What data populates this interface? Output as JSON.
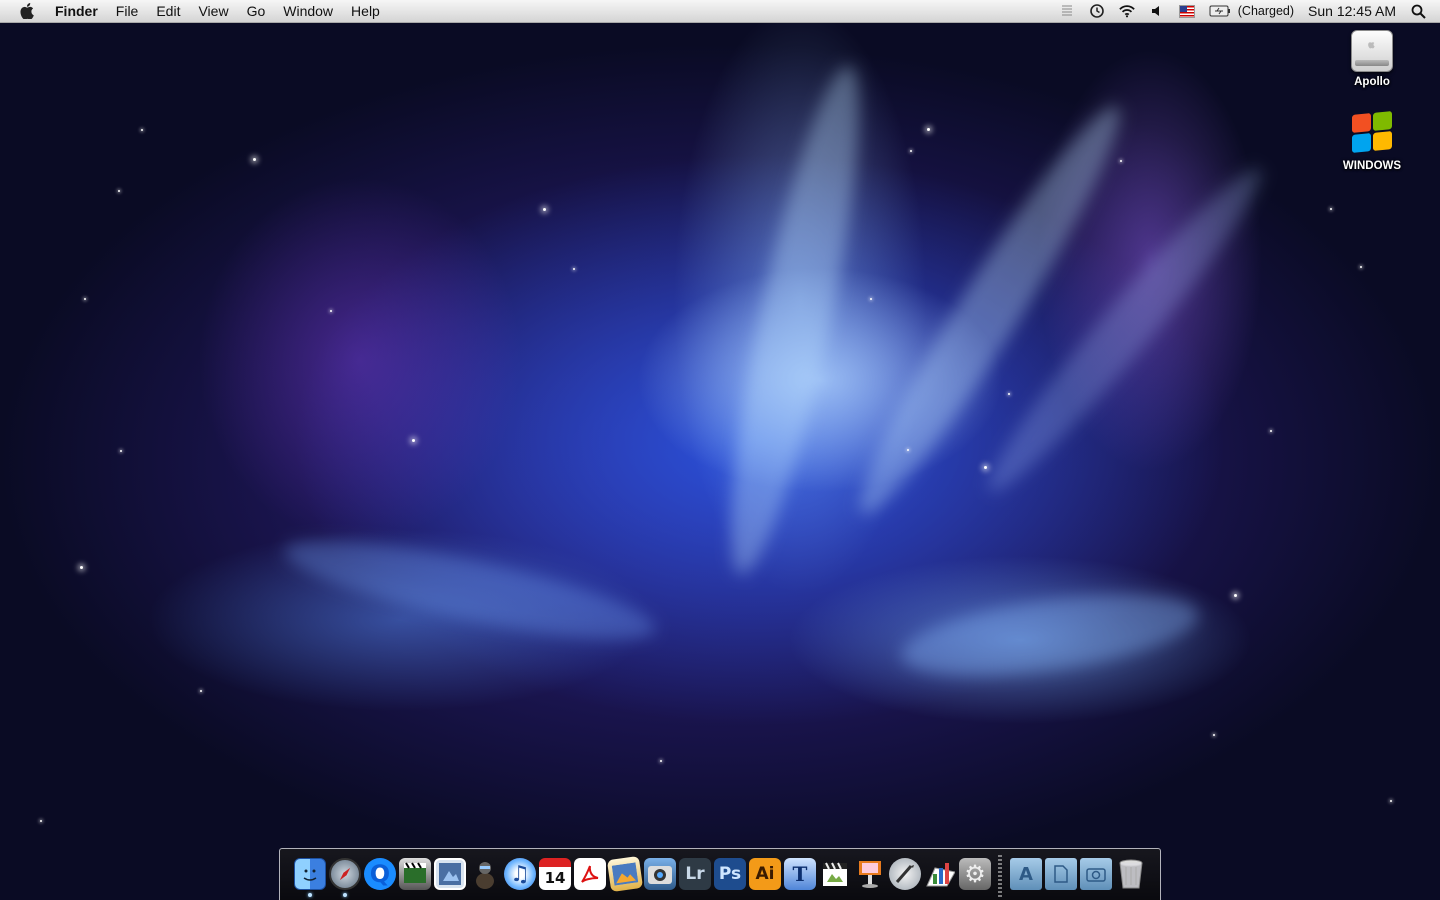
{
  "menubar": {
    "apple_icon": "apple-logo-icon",
    "app_name": "Finder",
    "menus": [
      "File",
      "Edit",
      "View",
      "Go",
      "Window",
      "Help"
    ],
    "status": {
      "battery_text": "(Charged)",
      "clock": "Sun 12:45 AM",
      "icons": [
        "menu-extra-icon",
        "time-machine-icon",
        "wifi-icon",
        "volume-icon",
        "us-flag-input-icon",
        "battery-icon",
        "spotlight-icon"
      ]
    }
  },
  "desktop": {
    "icons": [
      {
        "label": "Apollo",
        "icon": "hard-drive-icon"
      },
      {
        "label": "WINDOWS",
        "icon": "windows-drive-icon"
      }
    ]
  },
  "dock": {
    "items": [
      {
        "name": "finder",
        "glyph": ""
      },
      {
        "name": "safari",
        "glyph": ""
      },
      {
        "name": "quicktime",
        "glyph": "Q"
      },
      {
        "name": "imovie",
        "glyph": ""
      },
      {
        "name": "preview",
        "glyph": ""
      },
      {
        "name": "automator",
        "glyph": ""
      },
      {
        "name": "itunes",
        "glyph": "♫"
      },
      {
        "name": "ical",
        "glyph": "14"
      },
      {
        "name": "acrobat",
        "glyph": ""
      },
      {
        "name": "iphoto",
        "glyph": ""
      },
      {
        "name": "image-capture",
        "glyph": ""
      },
      {
        "name": "lightroom",
        "glyph": "Lr"
      },
      {
        "name": "photoshop",
        "glyph": "Ps"
      },
      {
        "name": "illustrator",
        "glyph": "Ai"
      },
      {
        "name": "textedit",
        "glyph": "T"
      },
      {
        "name": "final-cut",
        "glyph": ""
      },
      {
        "name": "keynote",
        "glyph": ""
      },
      {
        "name": "script-editor",
        "glyph": ""
      },
      {
        "name": "numbers",
        "glyph": ""
      },
      {
        "name": "system-preferences",
        "glyph": "⚙"
      },
      {
        "name": "applications-folder",
        "glyph": "A"
      },
      {
        "name": "documents-folder",
        "glyph": ""
      },
      {
        "name": "pictures-folder",
        "glyph": ""
      },
      {
        "name": "trash",
        "glyph": ""
      }
    ]
  }
}
